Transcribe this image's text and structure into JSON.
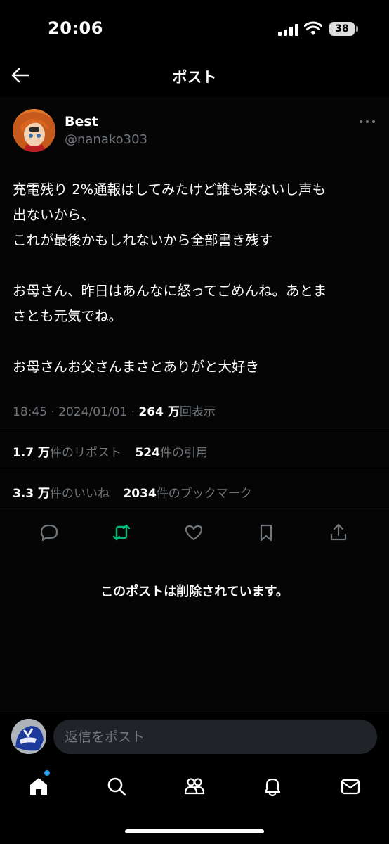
{
  "status_bar": {
    "time": "20:06",
    "battery": "38"
  },
  "header": {
    "title": "ポスト",
    "back_icon": "arrow-left-icon"
  },
  "post": {
    "author": {
      "display_name": "Best",
      "handle": "@nanako303"
    },
    "text_lines": [
      "充電残り 2%通報はしてみたけど誰も来ないし声も",
      "出ないから、",
      "これが最後かもしれないから全部書き残す",
      "お母さん、昨日はあんなに怒ってごめんね。あとま",
      "さとも元気でね。",
      "お母さんお父さんまさとありがと大好き"
    ],
    "meta": {
      "time": "18:45",
      "date": "2024/01/01",
      "views_count": "264 万",
      "views_label": "回表示"
    },
    "stats": {
      "reposts_count": "1.7 万",
      "reposts_label": "件のリポスト",
      "quotes_count": "524",
      "quotes_label": "件の引用",
      "likes_count": "3.3 万",
      "likes_label": "件のいいね",
      "bookmarks_count": "2034",
      "bookmarks_label": "件のブックマーク"
    },
    "actions": [
      "reply-icon",
      "repost-icon",
      "like-icon",
      "bookmark-icon",
      "share-icon"
    ],
    "repost_active_color": "#00ba7c",
    "deleted_notice": "このポストは削除されています。"
  },
  "reply_bar": {
    "placeholder": "返信をポスト"
  },
  "bottom_nav": {
    "items": [
      "home-icon",
      "search-icon",
      "communities-icon",
      "notifications-icon",
      "messages-icon"
    ],
    "notification_dot_color": "#1d9bf0"
  }
}
